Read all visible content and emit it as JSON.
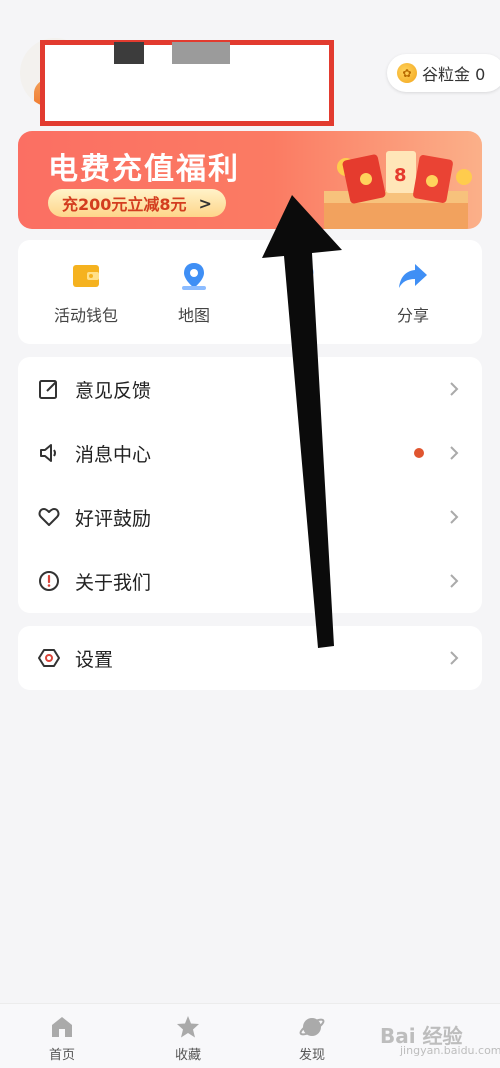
{
  "header": {
    "coin_label": "谷粒金 0"
  },
  "banner": {
    "title": "电费充值福利",
    "button_label": "充200元立减8元",
    "button_arrow": ">"
  },
  "quick_actions": [
    {
      "label": "活动钱包",
      "icon": "wallet-icon",
      "color": "#f5b21f"
    },
    {
      "label": "地图",
      "icon": "map-pin-icon",
      "color": "#3f8ff5"
    },
    {
      "label": "",
      "icon": "hidden-icon",
      "color": "#3f8ff5"
    },
    {
      "label": "分享",
      "icon": "share-arrow-icon",
      "color": "#3f8ff5"
    }
  ],
  "menu": [
    {
      "label": "意见反馈",
      "icon": "feedback-edit-icon",
      "badge": false
    },
    {
      "label": "消息中心",
      "icon": "speaker-icon",
      "badge": true
    },
    {
      "label": "好评鼓励",
      "icon": "heart-icon",
      "badge": false
    },
    {
      "label": "关于我们",
      "icon": "info-exclamation-icon",
      "badge": false
    }
  ],
  "settings": {
    "label": "设置",
    "icon": "hexagon-settings-icon"
  },
  "bottom_nav": [
    {
      "label": "首页",
      "icon": "home-icon"
    },
    {
      "label": "收藏",
      "icon": "star-icon"
    },
    {
      "label": "发现",
      "icon": "planet-icon"
    }
  ],
  "watermark": {
    "text": "Bai 经验",
    "sub": "jingyan.baidu.com"
  },
  "colors": {
    "accent": "#e23b2f",
    "banner": "#fb6f63",
    "badge": "#e0552f",
    "background": "#f5f5f7"
  }
}
